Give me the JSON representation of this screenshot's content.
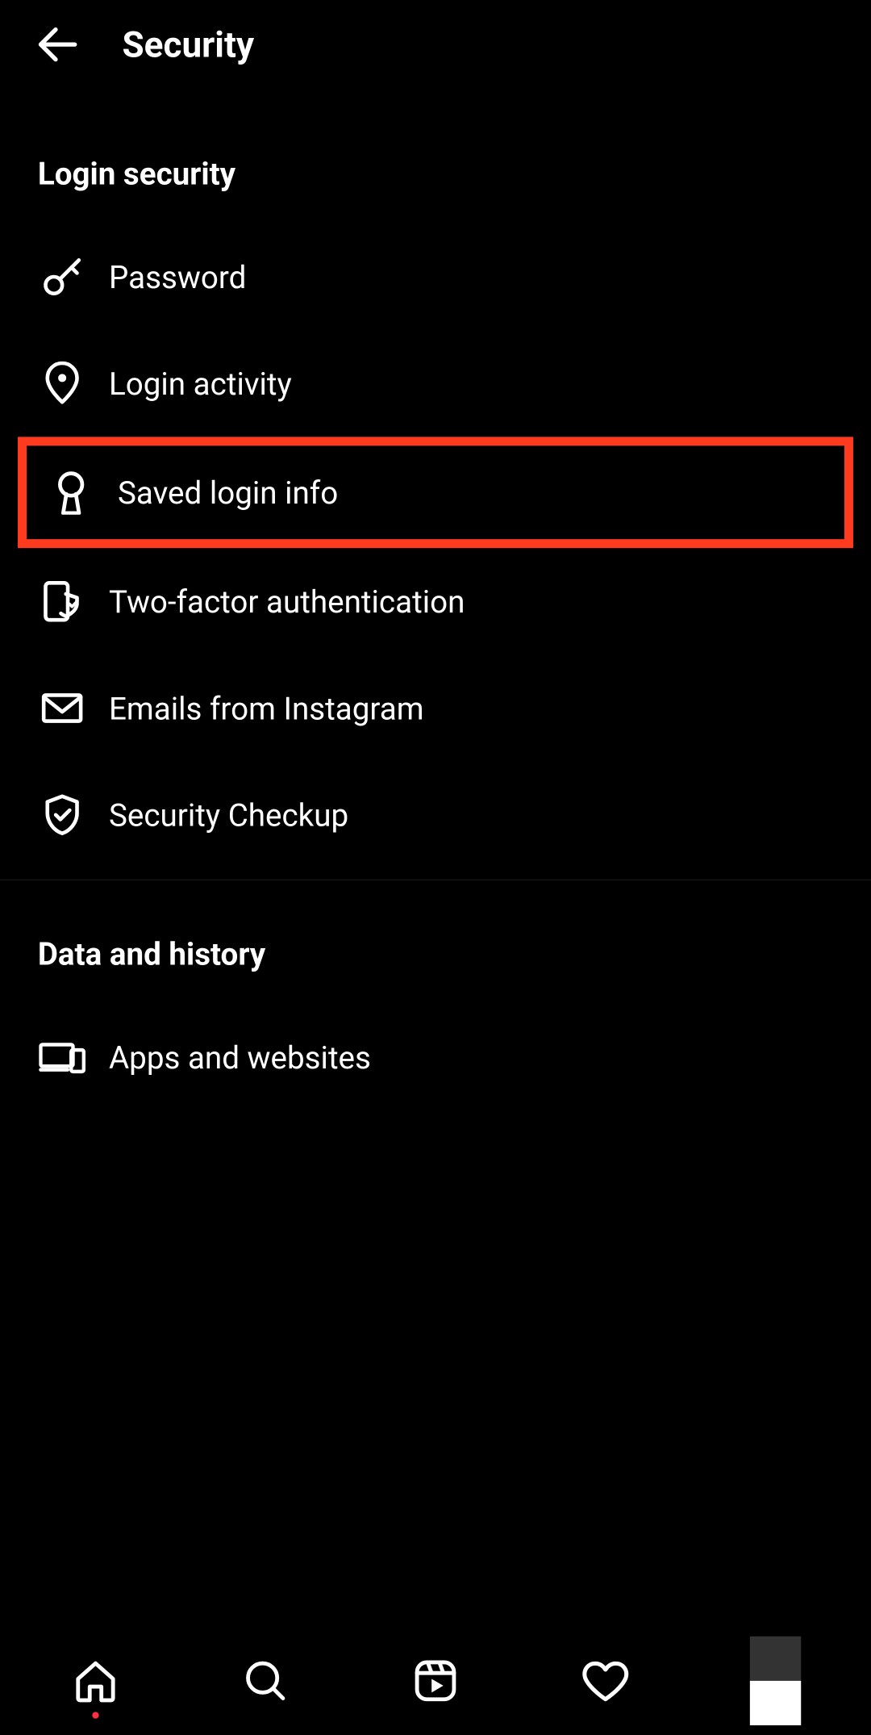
{
  "header": {
    "title": "Security"
  },
  "sections": [
    {
      "title": "Login security",
      "items": [
        {
          "label": "Password",
          "icon": "key"
        },
        {
          "label": "Login activity",
          "icon": "pin"
        },
        {
          "label": "Saved login info",
          "icon": "keyhole",
          "highlight": true
        },
        {
          "label": "Two-factor authentication",
          "icon": "device-shield"
        },
        {
          "label": "Emails from Instagram",
          "icon": "mail"
        },
        {
          "label": "Security Checkup",
          "icon": "shield-check"
        }
      ]
    },
    {
      "title": "Data and history",
      "items": [
        {
          "label": "Apps and websites",
          "icon": "devices"
        }
      ]
    }
  ],
  "highlight_color": "#ff3b1f"
}
